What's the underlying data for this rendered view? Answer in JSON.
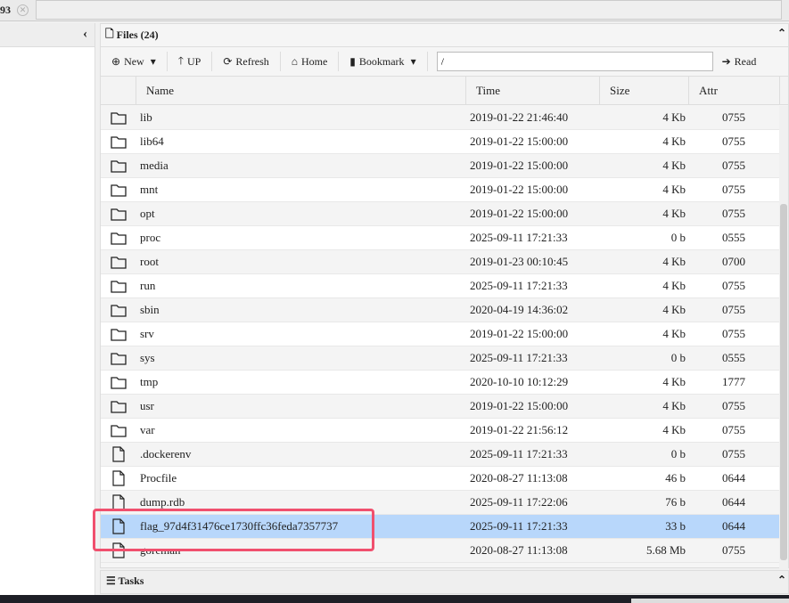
{
  "tab": {
    "label": "93"
  },
  "files": {
    "title": "Files (24)"
  },
  "toolbar": {
    "new": "New",
    "up": "UP",
    "refresh": "Refresh",
    "home": "Home",
    "bookmark": "Bookmark",
    "path": "/",
    "read": "Read"
  },
  "columns": [
    "Name",
    "Time",
    "Size",
    "Attr"
  ],
  "rows": [
    {
      "type": "folder",
      "name": "lib",
      "time": "2019-01-22 21:46:40",
      "size": "4 Kb",
      "attr": "0755"
    },
    {
      "type": "folder",
      "name": "lib64",
      "time": "2019-01-22 15:00:00",
      "size": "4 Kb",
      "attr": "0755"
    },
    {
      "type": "folder",
      "name": "media",
      "time": "2019-01-22 15:00:00",
      "size": "4 Kb",
      "attr": "0755"
    },
    {
      "type": "folder",
      "name": "mnt",
      "time": "2019-01-22 15:00:00",
      "size": "4 Kb",
      "attr": "0755"
    },
    {
      "type": "folder",
      "name": "opt",
      "time": "2019-01-22 15:00:00",
      "size": "4 Kb",
      "attr": "0755"
    },
    {
      "type": "folder",
      "name": "proc",
      "time": "2025-09-11 17:21:33",
      "size": "0 b",
      "attr": "0555"
    },
    {
      "type": "folder",
      "name": "root",
      "time": "2019-01-23 00:10:45",
      "size": "4 Kb",
      "attr": "0700"
    },
    {
      "type": "folder",
      "name": "run",
      "time": "2025-09-11 17:21:33",
      "size": "4 Kb",
      "attr": "0755"
    },
    {
      "type": "folder",
      "name": "sbin",
      "time": "2020-04-19 14:36:02",
      "size": "4 Kb",
      "attr": "0755"
    },
    {
      "type": "folder",
      "name": "srv",
      "time": "2019-01-22 15:00:00",
      "size": "4 Kb",
      "attr": "0755"
    },
    {
      "type": "folder",
      "name": "sys",
      "time": "2025-09-11 17:21:33",
      "size": "0 b",
      "attr": "0555"
    },
    {
      "type": "folder",
      "name": "tmp",
      "time": "2020-10-10 10:12:29",
      "size": "4 Kb",
      "attr": "1777"
    },
    {
      "type": "folder",
      "name": "usr",
      "time": "2019-01-22 15:00:00",
      "size": "4 Kb",
      "attr": "0755"
    },
    {
      "type": "folder",
      "name": "var",
      "time": "2019-01-22 21:56:12",
      "size": "4 Kb",
      "attr": "0755"
    },
    {
      "type": "file",
      "name": ".dockerenv",
      "time": "2025-09-11 17:21:33",
      "size": "0 b",
      "attr": "0755"
    },
    {
      "type": "file",
      "name": "Procfile",
      "time": "2020-08-27 11:13:08",
      "size": "46 b",
      "attr": "0644"
    },
    {
      "type": "file",
      "name": "dump.rdb",
      "time": "2025-09-11 17:22:06",
      "size": "76 b",
      "attr": "0644"
    },
    {
      "type": "file",
      "name": "flag_97d4f31476ce1730ffc36feda7357737",
      "time": "2025-09-11 17:21:33",
      "size": "33 b",
      "attr": "0644",
      "selected": true
    },
    {
      "type": "file",
      "name": "goreman",
      "time": "2020-08-27 11:13:08",
      "size": "5.68 Mb",
      "attr": "0755"
    }
  ],
  "tasks": {
    "title": "Tasks"
  },
  "colors": {
    "selected": "#b8d7fb",
    "highlight": "#f0506e"
  }
}
